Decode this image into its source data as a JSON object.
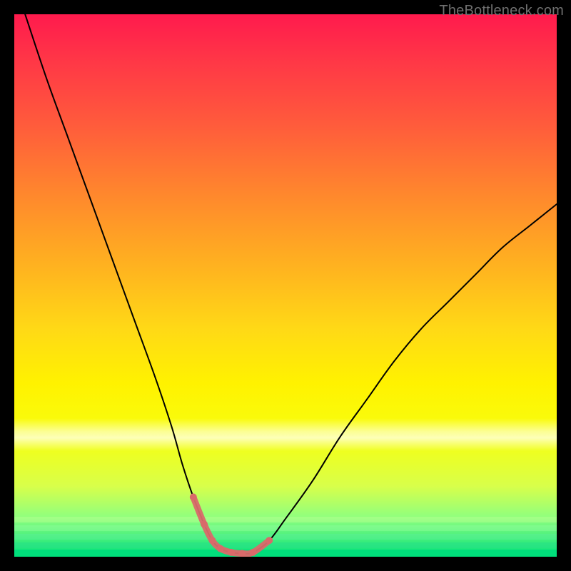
{
  "watermark": "TheBottleneck.com",
  "chart_data": {
    "type": "line",
    "title": "",
    "xlabel": "",
    "ylabel": "",
    "xlim": [
      0,
      100
    ],
    "ylim": [
      0,
      100
    ],
    "grid": false,
    "legend": false,
    "background_gradient": {
      "orientation": "vertical",
      "stops": [
        {
          "pos": 0.0,
          "color": "#ff1a4d"
        },
        {
          "pos": 0.08,
          "color": "#ff3547"
        },
        {
          "pos": 0.2,
          "color": "#ff5a3c"
        },
        {
          "pos": 0.34,
          "color": "#ff8a2c"
        },
        {
          "pos": 0.47,
          "color": "#ffb41f"
        },
        {
          "pos": 0.58,
          "color": "#ffd916"
        },
        {
          "pos": 0.68,
          "color": "#fff200"
        },
        {
          "pos": 0.78,
          "color": "#f7ff10"
        },
        {
          "pos": 0.87,
          "color": "#d8ff4a"
        },
        {
          "pos": 0.93,
          "color": "#8cff80"
        },
        {
          "pos": 1.0,
          "color": "#00e07a"
        }
      ]
    },
    "series": [
      {
        "name": "bottleneck-curve",
        "color": "#000000",
        "stroke_width": 2,
        "x": [
          2,
          6,
          10,
          14,
          18,
          22,
          26,
          29,
          31,
          33,
          35,
          36.5,
          38,
          40,
          42,
          44,
          47,
          50,
          55,
          60,
          65,
          70,
          75,
          80,
          85,
          90,
          95,
          100
        ],
        "y": [
          100,
          88,
          77,
          66,
          55,
          44,
          33,
          24,
          17,
          11,
          6,
          3,
          1.5,
          0.8,
          0.6,
          0.8,
          3,
          7,
          14,
          22,
          29,
          36,
          42,
          47,
          52,
          57,
          61,
          65
        ]
      }
    ],
    "highlight": {
      "name": "sweet-spot",
      "color": "#d96a6a",
      "stroke_width": 9,
      "dot_radius": 5,
      "x": [
        33,
        35,
        36.5,
        38,
        40,
        42,
        44,
        47
      ],
      "y": [
        11,
        6,
        3,
        1.5,
        0.8,
        0.6,
        0.8,
        3
      ]
    }
  }
}
